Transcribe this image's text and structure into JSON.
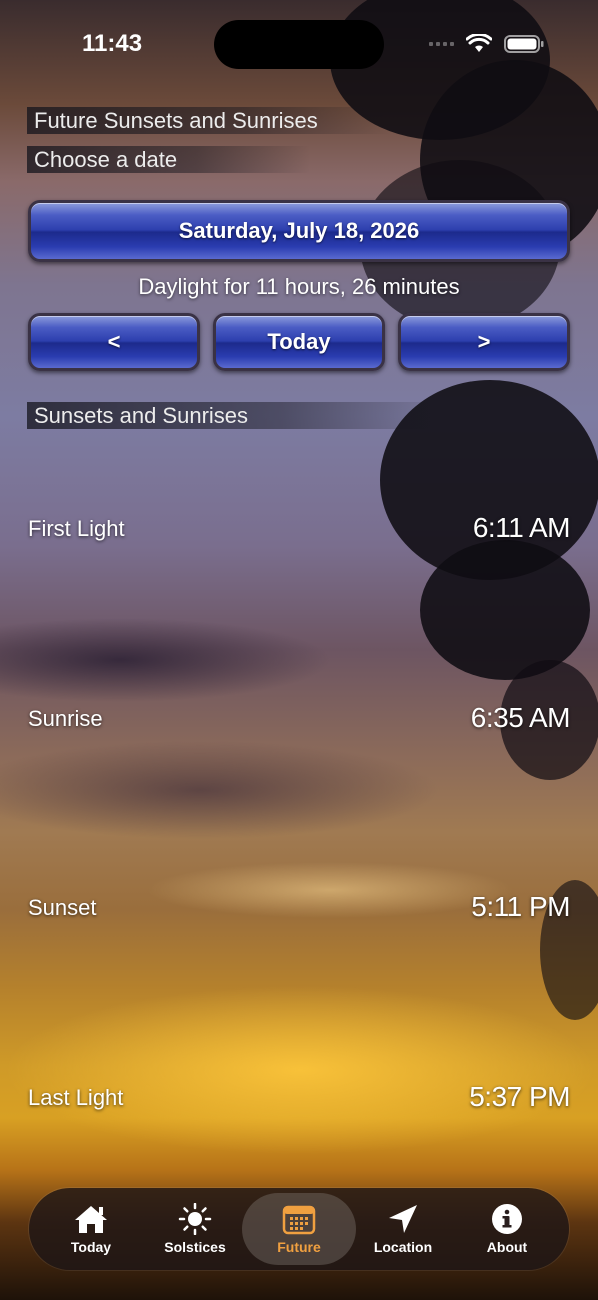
{
  "status": {
    "time": "11:43"
  },
  "headers": {
    "future": "Future Sunsets and Sunrises",
    "choose": "Choose a date",
    "section": "Sunsets and Sunrises"
  },
  "date_button": "Saturday, July 18, 2026",
  "daylight": "Daylight for 11 hours, 26 minutes",
  "nav": {
    "prev": "<",
    "today": "Today",
    "next": ">"
  },
  "rows": [
    {
      "label": "First Light",
      "time": "6:11 AM"
    },
    {
      "label": "Sunrise",
      "time": "6:35 AM"
    },
    {
      "label": "Sunset",
      "time": "5:11 PM"
    },
    {
      "label": "Last Light",
      "time": "5:37 PM"
    }
  ],
  "tabs": [
    {
      "label": "Today",
      "icon": "house-icon"
    },
    {
      "label": "Solstices",
      "icon": "sun-icon"
    },
    {
      "label": "Future",
      "icon": "calendar-icon",
      "active": true
    },
    {
      "label": "Location",
      "icon": "location-arrow-icon"
    },
    {
      "label": "About",
      "icon": "info-icon"
    }
  ],
  "colors": {
    "accent": "#f0a040",
    "button_blue": "#2d3fae"
  }
}
